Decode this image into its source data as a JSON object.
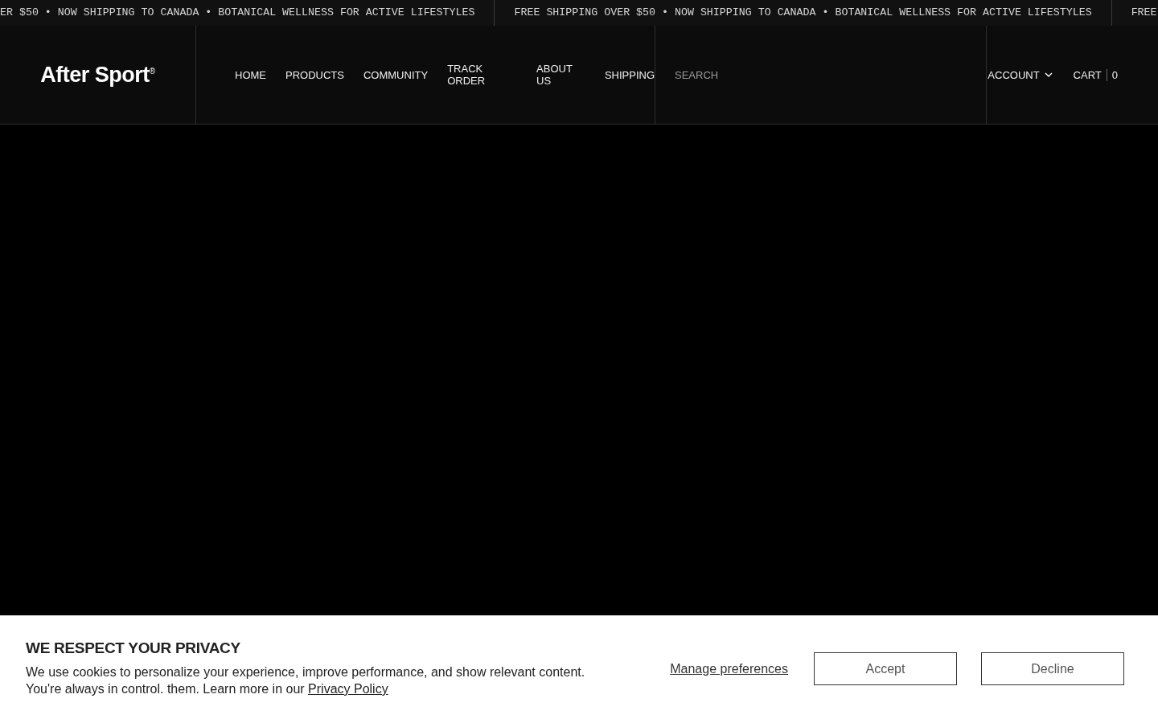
{
  "announcement_bar": {
    "messages": [
      "ER $50 • NOW SHIPPING TO CANADA • BOTANICAL WELLNESS FOR ACTIVE LIFESTYLES",
      "FREE SHIPPING OVER $50 • NOW SHIPPING TO CANADA • BOTANICAL WELLNESS FOR ACTIVE LIFESTYLES",
      "FREE"
    ]
  },
  "header": {
    "logo": "After Sport$^{®}$",
    "nav": [
      "HOME",
      "PRODUCTS",
      "COMMUNITY",
      "TRACK ORDER",
      "ABOUT US",
      "SHIPPING"
    ],
    "search": {
      "placeholder": "SEARCH"
    },
    "account": "ACCOUNT",
    "cart": {
      "label": "CART",
      "count": "0"
    }
  },
  "cookie_banner": {
    "title": "WE RESPECT YOUR PRIVACY",
    "text": "We use cookies to personalize your experience, improve performance, and show relevant content. You're always in control. them. Learn more in our ",
    "link": "Privacy Policy",
    "manage": "Manage preferences",
    "buttons": [
      "Accept",
      "Decline"
    ]
  }
}
